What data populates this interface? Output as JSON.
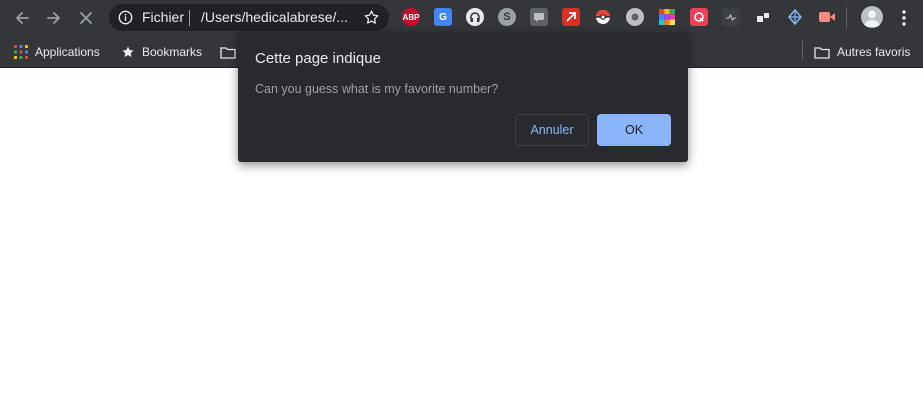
{
  "browser": {
    "omnibox": {
      "scheme_label": "Fichier",
      "path": "/Users/hedicalabrese/..."
    },
    "extensions": [
      {
        "name": "adblock-plus-icon",
        "label": "ABP",
        "color": "#c70d2c"
      },
      {
        "name": "google-translate-icon",
        "label": "G",
        "color": "#4285f4"
      },
      {
        "name": "headphones-icon",
        "label": "",
        "color": "#e8eaed"
      },
      {
        "name": "skype-icon",
        "label": "S",
        "color": "#9aa0a6"
      },
      {
        "name": "chat-extension-icon",
        "label": "",
        "color": "#5f6368"
      },
      {
        "name": "arrow-extension-icon",
        "label": "",
        "color": "#d93025"
      },
      {
        "name": "pokeball-icon",
        "label": "",
        "color": "#ea4335"
      },
      {
        "name": "circle-extension-icon",
        "label": "",
        "color": "#bdc1c6"
      },
      {
        "name": "color-grid-icon",
        "label": "",
        "color": "#fbbc04"
      },
      {
        "name": "pocket-icon",
        "label": "",
        "color": "#ef4056"
      },
      {
        "name": "terminal-extension-icon",
        "label": "",
        "color": "#3c4043"
      },
      {
        "name": "puzzle-extension-icon",
        "label": "",
        "color": "#e8eaed"
      },
      {
        "name": "network-extension-icon",
        "label": "",
        "color": "#8ab4f8"
      },
      {
        "name": "record-extension-icon",
        "label": "",
        "color": "#f28b82"
      }
    ]
  },
  "bookmarks": {
    "apps_label": "Applications",
    "bookmarks_label": "Bookmarks",
    "other_label": "Autres favoris"
  },
  "dialog": {
    "title": "Cette page indique",
    "message": "Can you guess what is my favorite number?",
    "cancel_label": "Annuler",
    "ok_label": "OK"
  },
  "colors": {
    "toolbar_bg": "#35363a",
    "dialog_bg": "#292a2d",
    "accent": "#8ab4f8"
  }
}
